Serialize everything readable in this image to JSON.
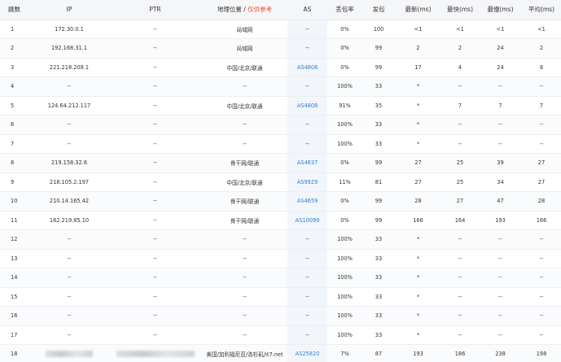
{
  "headers": {
    "hop": "跳数",
    "ip": "IP",
    "ptr": "PTR",
    "geo": "地理位置 / ",
    "geo_note": "仅供参考",
    "as": "AS",
    "loss": "丢包率",
    "sent": "发包",
    "last": "最新(ms)",
    "best": "最快(ms)",
    "worst": "最慢(ms)",
    "avg": "平均(ms)"
  },
  "colors": {
    "link": "#2b7fd8",
    "warning": "#e5533d",
    "header_bg": "#f5f6f8"
  },
  "rows": [
    {
      "hop": "1",
      "ip": "172.30.0.1",
      "ptr": "--",
      "geo": "局域网",
      "as": "--",
      "loss": "0%",
      "sent": "100",
      "last": "<1",
      "best": "<1",
      "worst": "<1",
      "avg": "<1"
    },
    {
      "hop": "2",
      "ip": "192.168.31.1",
      "ptr": "--",
      "geo": "局域网",
      "as": "--",
      "loss": "0%",
      "sent": "99",
      "last": "2",
      "best": "2",
      "worst": "24",
      "avg": "2"
    },
    {
      "hop": "3",
      "ip": "221.218.208.1",
      "ptr": "--",
      "geo": "中国/北京/联通",
      "as": "AS4808",
      "loss": "0%",
      "sent": "99",
      "last": "17",
      "best": "4",
      "worst": "24",
      "avg": "8"
    },
    {
      "hop": "4",
      "ip": "--",
      "ptr": "--",
      "geo": "--",
      "as": "--",
      "loss": "100%",
      "sent": "33",
      "last": "*",
      "best": "--",
      "worst": "--",
      "avg": "--"
    },
    {
      "hop": "5",
      "ip": "124.64.212.117",
      "ptr": "--",
      "geo": "中国/北京/联通",
      "as": "AS4808",
      "loss": "91%",
      "sent": "35",
      "last": "*",
      "best": "7",
      "worst": "7",
      "avg": "7"
    },
    {
      "hop": "6",
      "ip": "--",
      "ptr": "--",
      "geo": "--",
      "as": "--",
      "loss": "100%",
      "sent": "33",
      "last": "*",
      "best": "--",
      "worst": "--",
      "avg": "--"
    },
    {
      "hop": "7",
      "ip": "--",
      "ptr": "--",
      "geo": "--",
      "as": "--",
      "loss": "100%",
      "sent": "33",
      "last": "*",
      "best": "--",
      "worst": "--",
      "avg": "--"
    },
    {
      "hop": "8",
      "ip": "219.158.32.6",
      "ptr": "--",
      "geo": "骨干网/联通",
      "as": "AS4837",
      "loss": "0%",
      "sent": "99",
      "last": "27",
      "best": "25",
      "worst": "39",
      "avg": "27"
    },
    {
      "hop": "9",
      "ip": "218.105.2.197",
      "ptr": "--",
      "geo": "中国/北京/联通",
      "as": "AS9929",
      "loss": "11%",
      "sent": "81",
      "last": "27",
      "best": "25",
      "worst": "34",
      "avg": "27"
    },
    {
      "hop": "10",
      "ip": "210.14.165.42",
      "ptr": "--",
      "geo": "骨干网/联通",
      "as": "AS4659",
      "loss": "0%",
      "sent": "99",
      "last": "28",
      "best": "27",
      "worst": "47",
      "avg": "28"
    },
    {
      "hop": "11",
      "ip": "162.219.85.10",
      "ptr": "--",
      "geo": "骨干网/联通",
      "as": "AS10099",
      "loss": "0%",
      "sent": "99",
      "last": "166",
      "best": "164",
      "worst": "193",
      "avg": "166"
    },
    {
      "hop": "12",
      "ip": "--",
      "ptr": "--",
      "geo": "--",
      "as": "--",
      "loss": "100%",
      "sent": "33",
      "last": "*",
      "best": "--",
      "worst": "--",
      "avg": "--"
    },
    {
      "hop": "13",
      "ip": "--",
      "ptr": "--",
      "geo": "--",
      "as": "--",
      "loss": "100%",
      "sent": "33",
      "last": "*",
      "best": "--",
      "worst": "--",
      "avg": "--"
    },
    {
      "hop": "14",
      "ip": "--",
      "ptr": "--",
      "geo": "--",
      "as": "--",
      "loss": "100%",
      "sent": "33",
      "last": "*",
      "best": "--",
      "worst": "--",
      "avg": "--"
    },
    {
      "hop": "15",
      "ip": "--",
      "ptr": "--",
      "geo": "--",
      "as": "--",
      "loss": "100%",
      "sent": "33",
      "last": "*",
      "best": "--",
      "worst": "--",
      "avg": "--"
    },
    {
      "hop": "16",
      "ip": "--",
      "ptr": "--",
      "geo": "--",
      "as": "--",
      "loss": "100%",
      "sent": "33",
      "last": "*",
      "best": "--",
      "worst": "--",
      "avg": "--"
    },
    {
      "hop": "17",
      "ip": "--",
      "ptr": "--",
      "geo": "--",
      "as": "--",
      "loss": "100%",
      "sent": "33",
      "last": "*",
      "best": "--",
      "worst": "--",
      "avg": "--"
    },
    {
      "hop": "18",
      "ip": "",
      "ptr": "",
      "geo": "美国/加利福尼亚/洛杉矶/it7.net",
      "as": "AS25820",
      "loss": "7%",
      "sent": "87",
      "last": "193",
      "best": "186",
      "worst": "238",
      "avg": "198"
    }
  ]
}
